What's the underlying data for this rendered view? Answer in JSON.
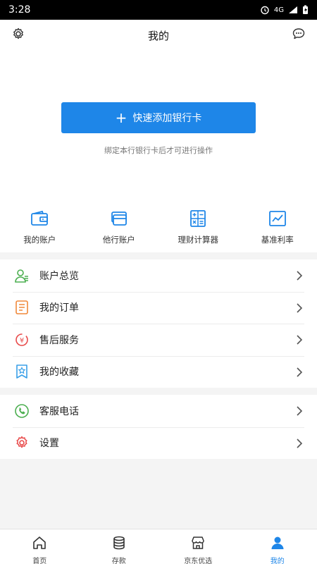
{
  "status_bar": {
    "time": "3:28",
    "network": "4G"
  },
  "header": {
    "title": "我的",
    "settings_icon": "gear-icon",
    "message_icon": "chat-bubble-icon"
  },
  "add_card": {
    "label": "快速添加银行卡",
    "hint": "绑定本行银行卡后才可进行操作",
    "accent": "#1e86e8"
  },
  "quick_actions": [
    {
      "label": "我的账户",
      "icon": "wallet-icon"
    },
    {
      "label": "他行账户",
      "icon": "cards-icon"
    },
    {
      "label": "理财计算器",
      "icon": "calculator-icon"
    },
    {
      "label": "基准利率",
      "icon": "trend-chart-icon"
    }
  ],
  "menu_group_1": [
    {
      "label": "账户总览",
      "icon": "person-icon"
    },
    {
      "label": "我的订单",
      "icon": "order-icon"
    },
    {
      "label": "售后服务",
      "icon": "service-icon"
    },
    {
      "label": "我的收藏",
      "icon": "star-bookmark-icon"
    }
  ],
  "menu_group_2": [
    {
      "label": "客服电话",
      "icon": "phone-icon"
    },
    {
      "label": "设置",
      "icon": "settings-gear-icon"
    }
  ],
  "tabs": [
    {
      "label": "首页",
      "icon": "home-icon"
    },
    {
      "label": "存款",
      "icon": "deposit-stack-icon"
    },
    {
      "label": "京东优选",
      "icon": "shop-icon"
    },
    {
      "label": "我的",
      "icon": "user-icon",
      "active": true
    }
  ]
}
